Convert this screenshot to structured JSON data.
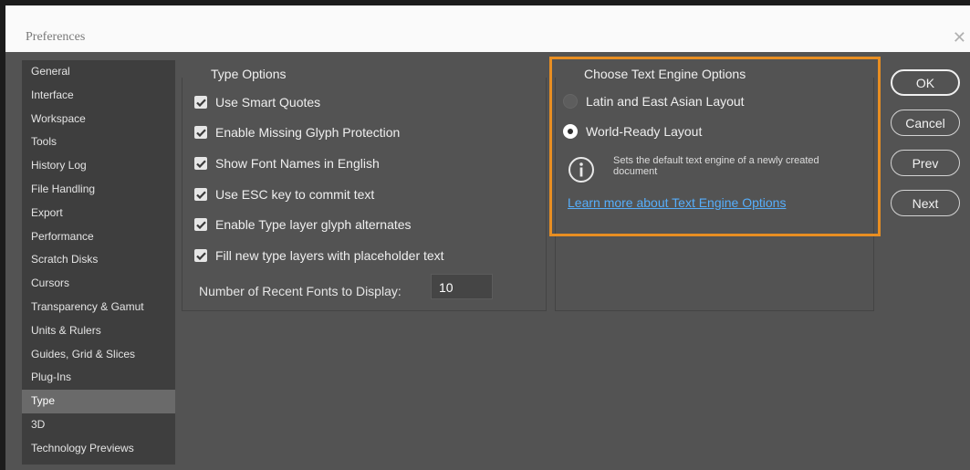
{
  "dialog": {
    "title": "Preferences",
    "close_symbol": "✕"
  },
  "sidebar": {
    "items": [
      {
        "label": "General"
      },
      {
        "label": "Interface"
      },
      {
        "label": "Workspace"
      },
      {
        "label": "Tools"
      },
      {
        "label": "History Log"
      },
      {
        "label": "File Handling"
      },
      {
        "label": "Export"
      },
      {
        "label": "Performance"
      },
      {
        "label": "Scratch Disks"
      },
      {
        "label": "Cursors"
      },
      {
        "label": "Transparency & Gamut"
      },
      {
        "label": "Units & Rulers"
      },
      {
        "label": "Guides, Grid & Slices"
      },
      {
        "label": "Plug-Ins"
      },
      {
        "label": "Type",
        "selected": true
      },
      {
        "label": "3D"
      },
      {
        "label": "Technology Previews"
      }
    ]
  },
  "type_options": {
    "title": "Type Options",
    "checkboxes": [
      {
        "label": "Use Smart Quotes",
        "checked": true
      },
      {
        "label": "Enable Missing Glyph Protection",
        "checked": true
      },
      {
        "label": "Show Font Names in English",
        "checked": true
      },
      {
        "label": "Use ESC key to commit text",
        "checked": true
      },
      {
        "label": "Enable Type layer glyph alternates",
        "checked": true
      },
      {
        "label": "Fill new type layers with placeholder text",
        "checked": true
      }
    ],
    "recent_fonts_label": "Number of Recent Fonts to Display:",
    "recent_fonts_value": "10"
  },
  "text_engine": {
    "title": "Choose Text Engine Options",
    "options": [
      {
        "label": "Latin and East Asian Layout",
        "selected": false
      },
      {
        "label": "World-Ready Layout",
        "selected": true
      }
    ],
    "info_icon": "info-icon",
    "info_text": "Sets the default text engine of a newly created document",
    "learn_more": "Learn more about Text Engine Options",
    "highlight_color": "#e88e22"
  },
  "buttons": {
    "ok": "OK",
    "cancel": "Cancel",
    "prev": "Prev",
    "next": "Next"
  }
}
